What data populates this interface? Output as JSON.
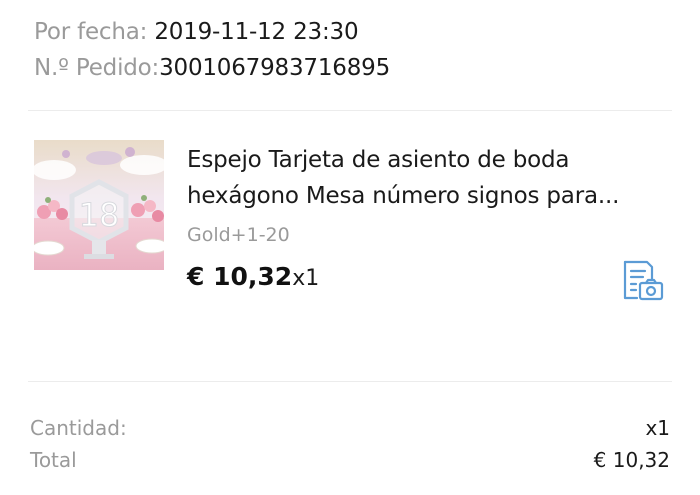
{
  "order": {
    "date_label": "Por fecha: ",
    "date_value": "2019-11-12 23:30",
    "id_label": "N.º Pedido:",
    "id_value": "3001067983716895"
  },
  "product": {
    "title_line1": "Espejo Tarjeta de asiento de boda",
    "title_line2": "hexágono Mesa número signos para...",
    "variant": "Gold+1-20",
    "price": "€ 10,32",
    "quantity": "x1",
    "image_number": "18",
    "snapshot_icon": "document-camera-icon"
  },
  "summary": {
    "quantity_label": "Cantidad:",
    "quantity_value": "x1",
    "total_label": "Total",
    "total_value": "€ 10,32"
  },
  "colors": {
    "accent_icon": "#5b9bd5",
    "muted_text": "#9a9a9a",
    "primary_text": "#1a1a1a"
  }
}
